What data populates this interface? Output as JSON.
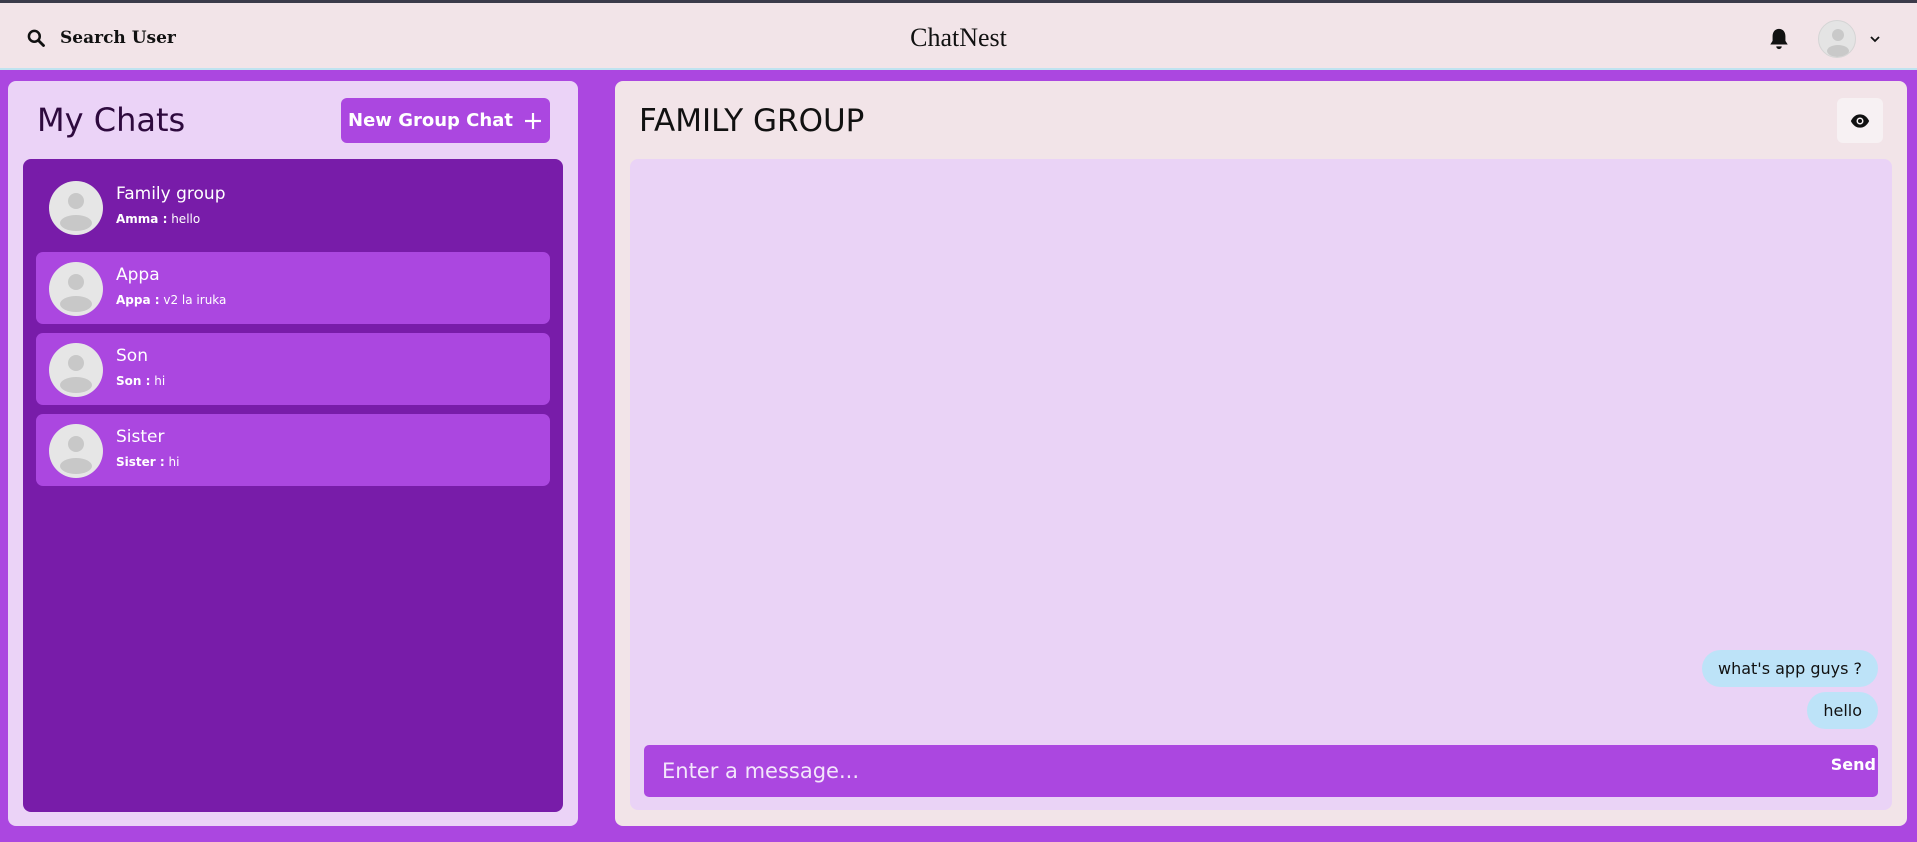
{
  "header": {
    "search_label": "Search User",
    "app_title": "ChatNest"
  },
  "sidebar": {
    "title": "My Chats",
    "new_group_label": "New Group Chat",
    "chats": [
      {
        "name": "Family group",
        "sender": "Amma :",
        "message": "hello",
        "active": true
      },
      {
        "name": "Appa",
        "sender": "Appa :",
        "message": "v2 la iruka",
        "active": false
      },
      {
        "name": "Son",
        "sender": "Son :",
        "message": "hi",
        "active": false
      },
      {
        "name": "Sister",
        "sender": "Sister :",
        "message": "hi",
        "active": false
      }
    ]
  },
  "chat": {
    "title": "FAMILY GROUP",
    "messages": [
      {
        "text": "what's app guys ?"
      },
      {
        "text": "hello"
      }
    ],
    "input_placeholder": "Enter a message...",
    "send_label": "Send"
  },
  "colors": {
    "primary": "#ab47e0",
    "chat_list_bg": "#781ca9",
    "panel_bg": "#f2e4e8",
    "bubble_bg": "#bde3f8"
  },
  "icons": {
    "search": "search-icon",
    "bell": "bell-icon",
    "plus": "plus-icon",
    "eye": "eye-icon",
    "chevron": "chevron-down-icon",
    "avatar": "user-avatar-icon"
  }
}
